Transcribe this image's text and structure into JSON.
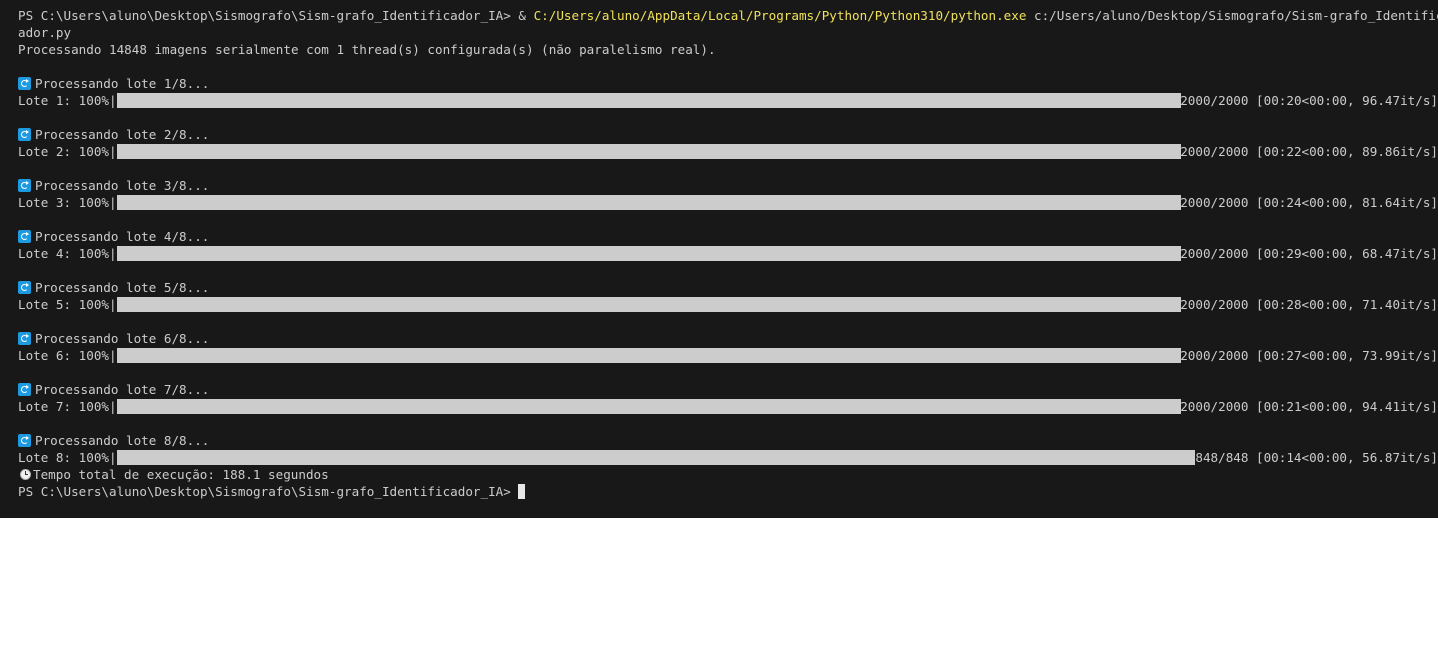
{
  "terminal": {
    "prompt": "PS C:\\Users\\aluno\\Desktop\\Sismografo\\Sism-grafo_Identificador_IA> ",
    "command_op": "& ",
    "command_exe": "C:/Users/aluno/AppData/Local/Programs/Python/Python310/python.exe",
    "command_arg_line1": " c:/Users/aluno/Desktop/Sismografo/Sism-grafo_Identificador_IA/analis",
    "command_arg_line2": "ador.py",
    "info_line": "Processando 14848 imagens serialmente com 1 thread(s) configurada(s) (não paralelismo real).",
    "refresh_icon": "refresh-icon",
    "clock_icon": "stopwatch-icon",
    "batches": [
      {
        "header": "Processando lote 1/8...",
        "label": "Lote 1: 100%",
        "progress": 1.0,
        "stats": " 2000/2000 [00:20<00:00, 96.47it/s]"
      },
      {
        "header": "Processando lote 2/8...",
        "label": "Lote 2: 100%",
        "progress": 1.0,
        "stats": " 2000/2000 [00:22<00:00, 89.86it/s]"
      },
      {
        "header": "Processando lote 3/8...",
        "label": "Lote 3: 100%",
        "progress": 1.0,
        "stats": " 2000/2000 [00:24<00:00, 81.64it/s]"
      },
      {
        "header": "Processando lote 4/8...",
        "label": "Lote 4: 100%",
        "progress": 1.0,
        "stats": " 2000/2000 [00:29<00:00, 68.47it/s]"
      },
      {
        "header": "Processando lote 5/8...",
        "label": "Lote 5: 100%",
        "progress": 1.0,
        "stats": " 2000/2000 [00:28<00:00, 71.40it/s]"
      },
      {
        "header": "Processando lote 6/8...",
        "label": "Lote 6: 100%",
        "progress": 1.0,
        "stats": " 2000/2000 [00:27<00:00, 73.99it/s]"
      },
      {
        "header": "Processando lote 7/8...",
        "label": "Lote 7: 100%",
        "progress": 1.0,
        "stats": " 2000/2000 [00:21<00:00, 94.41it/s]"
      },
      {
        "header": "Processando lote 8/8...",
        "label": "Lote 8: 100%",
        "progress": 1.0,
        "stats": " 848/848 [00:14<00:00, 56.87it/s]"
      }
    ],
    "total_time": "Tempo total de execução: 188.1 segundos",
    "final_prompt": "PS C:\\Users\\aluno\\Desktop\\Sismografo\\Sism-grafo_Identificador_IA> ",
    "colors": {
      "background": "#181818",
      "text": "#cccccc",
      "exe_path": "#f1e05a",
      "bar": "#cccccc"
    }
  }
}
